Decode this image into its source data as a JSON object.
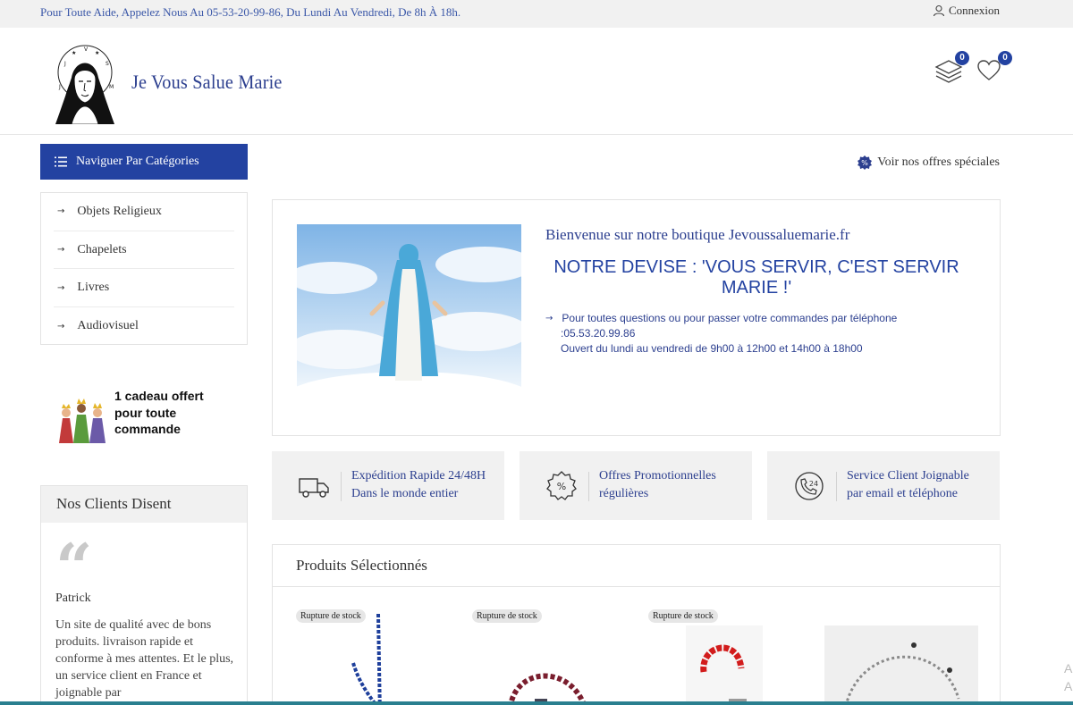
{
  "topbar": {
    "help_text": "Pour Toute Aide, Appelez Nous Au 05-53-20-99-86, Du Lundi Au Vendredi, De 8h À 18h.",
    "login_label": "Connexion",
    "login_icon": "user-icon"
  },
  "header": {
    "site_name": "Je Vous Salue Marie",
    "compare_count": "0",
    "wishlist_count": "0",
    "compare_icon": "layers-icon",
    "wishlist_icon": "heart-icon"
  },
  "categories": {
    "button_label": "Naviguer Par Catégories",
    "items": [
      {
        "label": "Objets Religieux"
      },
      {
        "label": "Chapelets"
      },
      {
        "label": "Livres"
      },
      {
        "label": "Audiovisuel"
      }
    ]
  },
  "gift": {
    "line1_prefix": "1 cadeau ",
    "line1_bold": "offert",
    "line2": "pour toute",
    "line3": "commande"
  },
  "testimonials": {
    "title": "Nos Clients Disent",
    "name": "Patrick",
    "text": "Un site de qualité avec de bons produits. livraison rapide et conforme à mes attentes. Et le plus, un service client en France et joignable par"
  },
  "offers_link": "Voir nos offres spéciales",
  "welcome": {
    "title": "Bienvenue sur notre boutique Jevoussaluemarie.fr",
    "motto": "NOTRE DEVISE : 'VOUS SERVIR, C'EST SERVIR MARIE !'",
    "info_line1": "Pour toutes questions ou pour passer votre commandes par téléphone",
    "info_line2": ":05.53.20.99.86",
    "info_line3": "Ouvert du lundi au vendredi de 9h00 à 12h00 et 14h00 à 18h00"
  },
  "features": [
    {
      "icon": "truck-icon",
      "line1": "Expédition Rapide 24/48H",
      "line2": "Dans le monde entier"
    },
    {
      "icon": "percent-badge-icon",
      "line1": "Offres Promotionnelles",
      "line2": "régulières"
    },
    {
      "icon": "phone-24-icon",
      "line1": "Service Client Joignable",
      "line2": "par email et téléphone"
    }
  ],
  "products": {
    "title": "Produits Sélectionnés",
    "items": [
      {
        "badge": "Rupture de stock"
      },
      {
        "badge": "Rupture de stock"
      },
      {
        "badge": "Rupture de stock"
      },
      {
        "badge": ""
      }
    ]
  },
  "colors": {
    "brand_blue": "#2342a1",
    "text_blue": "#2c3f8f",
    "panel_gray": "#f1f1f1"
  }
}
